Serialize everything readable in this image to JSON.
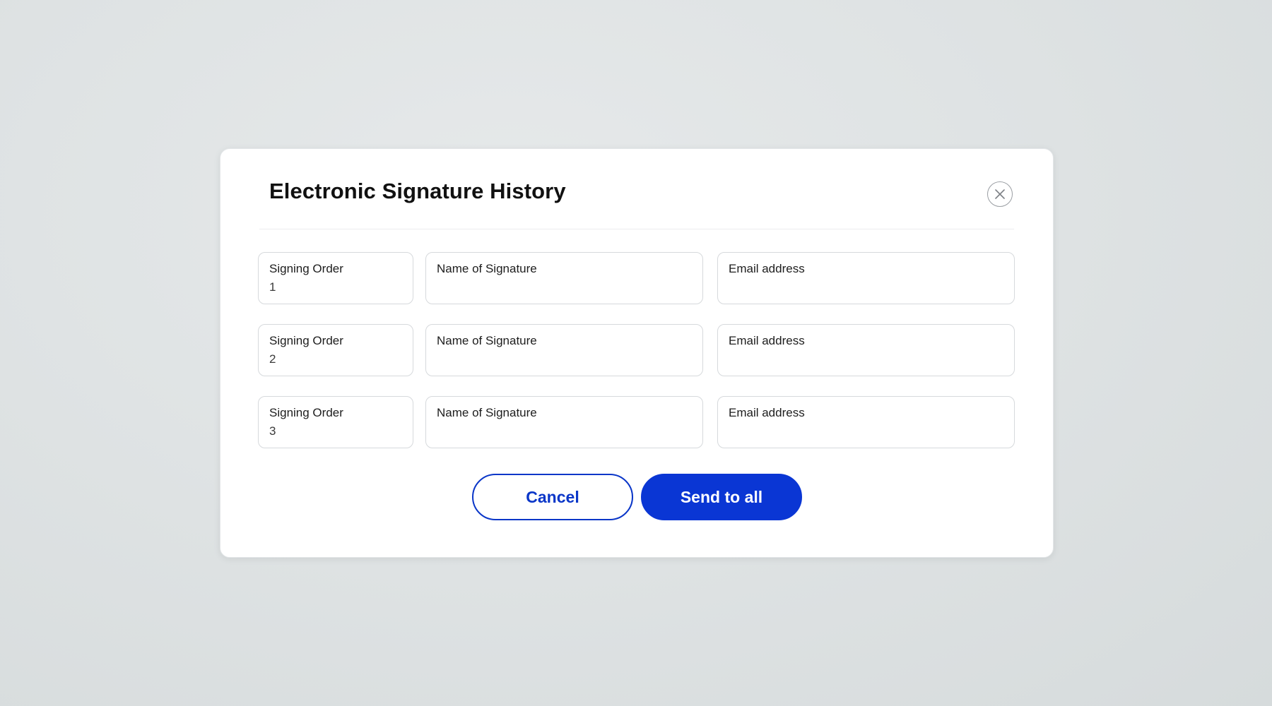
{
  "dialog": {
    "title": "Electronic Signature History",
    "close_icon": "close-icon"
  },
  "rows": [
    {
      "order_label": "Signing Order",
      "order_value": "1",
      "name_label": "Name of Signature",
      "name_value": "",
      "email_label": "Email address",
      "email_value": ""
    },
    {
      "order_label": "Signing Order",
      "order_value": "2",
      "name_label": "Name of Signature",
      "name_value": "",
      "email_label": "Email address",
      "email_value": ""
    },
    {
      "order_label": "Signing Order",
      "order_value": "3",
      "name_label": "Name of Signature",
      "name_value": "",
      "email_label": "Email address",
      "email_value": ""
    }
  ],
  "actions": {
    "cancel_label": "Cancel",
    "send_label": "Send to all"
  },
  "colors": {
    "accent": "#0a36d4",
    "field_border": "#d6d9dc",
    "background": "#dfe3e4"
  }
}
